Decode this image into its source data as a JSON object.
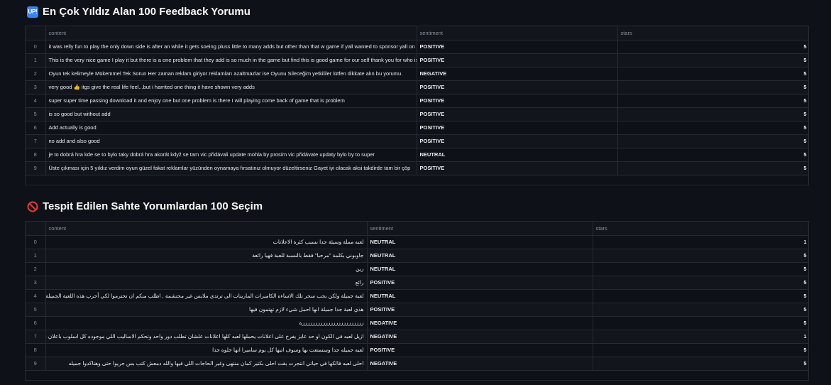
{
  "section1": {
    "icon": "up-icon",
    "title": "En Çok Yıldız Alan 100 Feedback Yorumu",
    "columns": [
      "",
      "content",
      "sentiment",
      "stars"
    ],
    "rows": [
      {
        "idx": "0",
        "content": "it was relly fun to play the only down side is after an while it gets soeing pluss little to many adds but other than that w game if yall wanted to sponsor yall on m",
        "sentiment": "POSITIVE",
        "stars": "5"
      },
      {
        "idx": "1",
        "content": "This is the very nice game I play it but there is a one problem that they add is so much in the game but find this is good game for our self thank you for who is m",
        "sentiment": "POSITIVE",
        "stars": "5"
      },
      {
        "idx": "2",
        "content": "Oyun tek kelimeyle Mükemmel Tek Sorun Her zaman reklam giriyor reklamları azaltmazlar ise Oyunu Sileceğim yetkililer lütfen dikkate alın bu yorumu.",
        "sentiment": "NEGATIVE",
        "stars": "5"
      },
      {
        "idx": "3",
        "content": "very good 👍 itgs give the real life feel...but i harrited one thing it have shown very adds",
        "sentiment": "POSITIVE",
        "stars": "5"
      },
      {
        "idx": "4",
        "content": "super super time passing download it and enjoy one but one problem is there I will playing come back of game that is problem",
        "sentiment": "POSITIVE",
        "stars": "5"
      },
      {
        "idx": "5",
        "content": "is so good but without add",
        "sentiment": "POSITIVE",
        "stars": "5"
      },
      {
        "idx": "6",
        "content": "Add actually is good",
        "sentiment": "POSITIVE",
        "stars": "5"
      },
      {
        "idx": "7",
        "content": "no add and also good",
        "sentiment": "POSITIVE",
        "stars": "5"
      },
      {
        "idx": "8",
        "content": "je to dobrá hra kde se to bylo taky dobrá hra akorát když se tam vic přidávali update mohla by prosím vic přidávate updaty bylo by to super",
        "sentiment": "NEUTRAL",
        "stars": "5"
      },
      {
        "idx": "9",
        "content": "Üste çıkması için 5 yıldız verdim oyun güzel fakat reklamlar yüzünden oynamaya fırsatınız olmuyor düzeltirseniz Gayet iyi olacak aksi takdirde tam bir çöp",
        "sentiment": "POSITIVE",
        "stars": "5"
      }
    ]
  },
  "section2": {
    "icon": "prohibited-icon",
    "title": "Tespit Edilen Sahte Yorumlardan 100 Seçim",
    "columns": [
      "",
      "content",
      "sentiment",
      "stars"
    ],
    "rows": [
      {
        "idx": "0",
        "content": "لعبه مملة وسيئة جدا بسبب كثرة الاعلانات",
        "sentiment": "NEUTRAL",
        "stars": "1"
      },
      {
        "idx": "1",
        "content": "جاوبوني بكلمة \"مرحبا\" فقط بالنسبة للعبة فهيا رائعة",
        "sentiment": "NEUTRAL",
        "stars": "5"
      },
      {
        "idx": "2",
        "content": "زين",
        "sentiment": "NEUTRAL",
        "stars": "5"
      },
      {
        "idx": "3",
        "content": "رائع",
        "sentiment": "POSITIVE",
        "stars": "5"
      },
      {
        "idx": "4",
        "content": "لعبة جميلة ولكن يجب سحر تلك الاساءه الكاميرات المارينات الي ترتدي ملابس غير محتشمة , اطلب منكم ان تحترموا لكي أجرب هذه اللعبة الجميلة في جو عائلي، وشكرا. 🤍 🤍 💕",
        "sentiment": "NEUTRAL",
        "stars": "5"
      },
      {
        "idx": "5",
        "content": "هذي لعبة جدا جميلة انها احمل شيء لازم تهتمون فيها",
        "sentiment": "POSITIVE",
        "stars": "5"
      },
      {
        "idx": "6",
        "content": "ززززززززززززززززززززززززة",
        "sentiment": "NEGATIVE",
        "stars": "5"
      },
      {
        "idx": "7",
        "content": "ازيل لعبه في الكون او حد عايز يفرح على اعلانات يحملها لعبه كلها اعلانات علشان تطلب دور واحد وتحكم الاساليب اللي موجوده كل اسلوب باعلان غير ان فتح الدور باعلان وكما انهم",
        "sentiment": "NEGATIVE",
        "stars": "1"
      },
      {
        "idx": "8",
        "content": "لعبه جميله جدا وستمتعت بها وسوف اتيها كل يوم ساميرا انها حلوه جدا",
        "sentiment": "POSITIVE",
        "stars": "5"
      },
      {
        "idx": "9",
        "content": "احلى لعبه فالكها في حياتي انتجرت بقت احلى بكتير كمان منتهى وغير الحاجات اللي فيها والله دمعش كتب بس جريوا حتى وهتاكدوا جميله",
        "sentiment": "NEGATIVE",
        "stars": "5"
      }
    ]
  }
}
